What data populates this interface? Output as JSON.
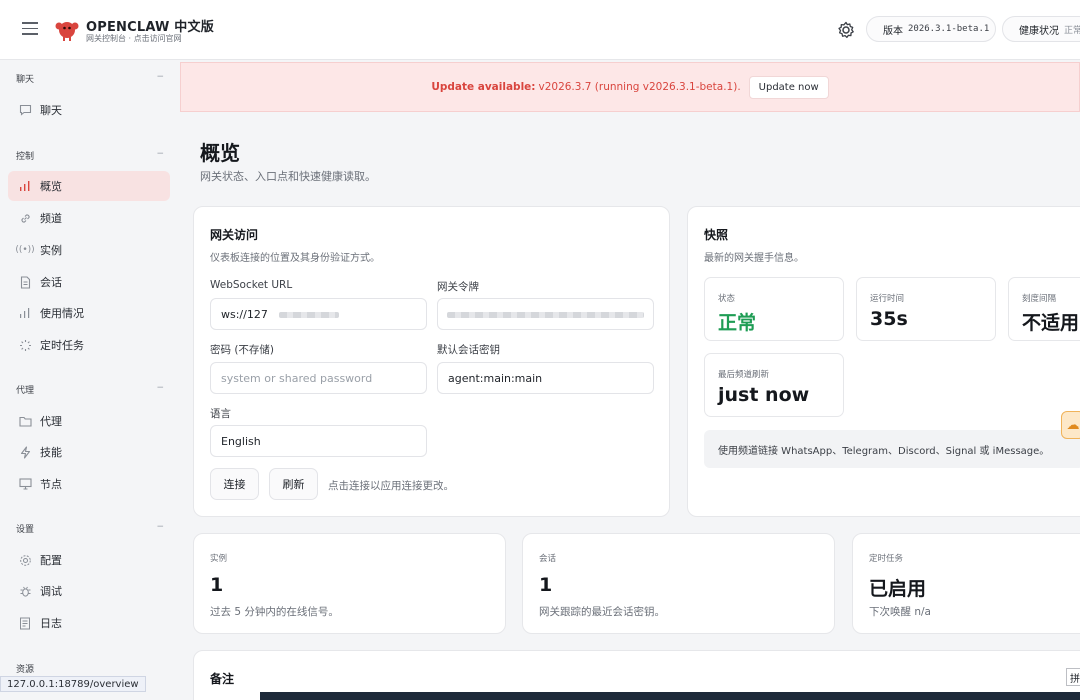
{
  "header": {
    "brand_title": "OPENCLAW 中文版",
    "brand_subtitle": "网关控制台 · 点击访问官网",
    "version_label": "版本",
    "version_value": "2026.3.1-beta.1",
    "health_label": "健康状况",
    "health_value": "正常",
    "colors": {
      "version_dot": "#e9a23b",
      "health_dot": "#22b35e",
      "logo": "#d9453e"
    }
  },
  "sidebar": {
    "sections": [
      {
        "title": "聊天",
        "toggle": "−",
        "items": [
          {
            "label": "聊天",
            "icon": "chat-bubble-icon"
          }
        ]
      },
      {
        "title": "控制",
        "toggle": "−",
        "items": [
          {
            "label": "概览",
            "icon": "bar-chart-icon",
            "active": true
          },
          {
            "label": "频道",
            "icon": "link-icon"
          },
          {
            "label": "实例",
            "icon": "broadcast-icon"
          },
          {
            "label": "会话",
            "icon": "document-icon"
          },
          {
            "label": "使用情况",
            "icon": "bar-chart-icon"
          },
          {
            "label": "定时任务",
            "icon": "loader-icon"
          }
        ]
      },
      {
        "title": "代理",
        "toggle": "−",
        "items": [
          {
            "label": "代理",
            "icon": "folder-icon"
          },
          {
            "label": "技能",
            "icon": "lightning-icon"
          },
          {
            "label": "节点",
            "icon": "monitor-icon"
          }
        ]
      },
      {
        "title": "设置",
        "toggle": "−",
        "items": [
          {
            "label": "配置",
            "icon": "gear-icon"
          },
          {
            "label": "调试",
            "icon": "bug-icon"
          },
          {
            "label": "日志",
            "icon": "log-icon"
          }
        ]
      },
      {
        "title": "资源"
      }
    ]
  },
  "banner": {
    "bold": "Update available:",
    "text": "v2026.3.7 (running v2026.3.1-beta.1).",
    "button": "Update now"
  },
  "page": {
    "title": "概览",
    "subtitle": "网关状态、入口点和快速健康读取。"
  },
  "gateway": {
    "title": "网关访问",
    "description": "仪表板连接的位置及其身份验证方式。",
    "ws_label": "WebSocket URL",
    "ws_value": "ws://127",
    "token_label": "网关令牌",
    "password_label": "密码 (不存储)",
    "password_placeholder": "system or shared password",
    "session_label": "默认会话密钥",
    "session_value": "agent:main:main",
    "language_label": "语言",
    "language_value": "English",
    "connect_button": "连接",
    "refresh_button": "刷新",
    "hint": "点击连接以应用连接更改。"
  },
  "snapshot": {
    "title": "快照",
    "description": "最新的网关握手信息。",
    "metrics": [
      {
        "label": "状态",
        "value": "正常"
      },
      {
        "label": "运行时间",
        "value": "35s"
      },
      {
        "label": "刻度间隔",
        "value": "不适用"
      },
      {
        "label": "最后频道刷新",
        "value": "just now"
      }
    ],
    "note": "使用频道链接 WhatsApp、Telegram、Discord、Signal 或 iMessage。"
  },
  "stats": [
    {
      "label": "实例",
      "value": "1",
      "desc": "过去 5 分钟内的在线信号。"
    },
    {
      "label": "会话",
      "value": "1",
      "desc": "网关跟踪的最近会话密钥。"
    },
    {
      "label": "定时任务",
      "value": "已启用",
      "desc": "下次唤醒 n/a"
    }
  ],
  "notes": {
    "title": "备注"
  },
  "statusbar": {
    "url": "127.0.0.1:18789/overview",
    "ime": "拼"
  }
}
